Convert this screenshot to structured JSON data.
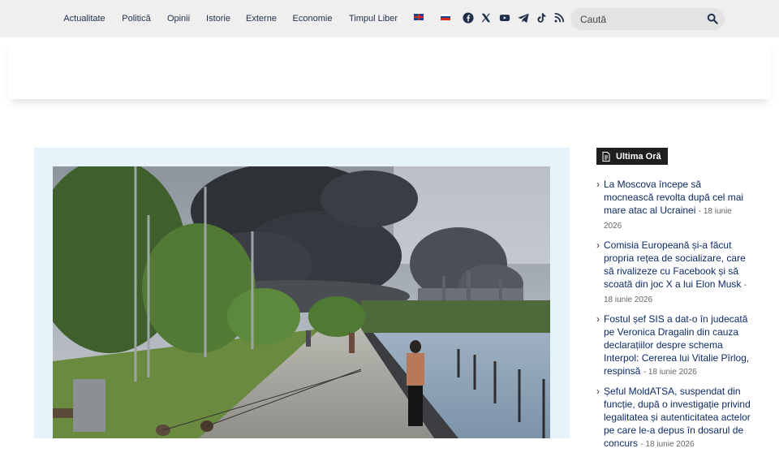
{
  "nav": {
    "items": [
      {
        "label": "Actualitate",
        "color": "#3aa6d6"
      },
      {
        "label": "Politică",
        "color": "#f2c71b"
      },
      {
        "label": "Opinii",
        "color": "#e2433e"
      },
      {
        "label": "Istorie",
        "color": "#f28b2b"
      },
      {
        "label": "Externe",
        "color": "#9b55b5"
      },
      {
        "label": "Economie",
        "color": "#46bb6e"
      },
      {
        "label": "Timpul Liber",
        "color": "#ec7fb3"
      }
    ],
    "languages": [
      "uk-flag-icon",
      "ru-flag-icon"
    ],
    "social": [
      "facebook-icon",
      "x-icon",
      "youtube-icon",
      "telegram-icon",
      "tiktok-icon",
      "rss-icon"
    ]
  },
  "search": {
    "placeholder": "Caută"
  },
  "sidebar": {
    "badge": "Ultima Oră",
    "items": [
      {
        "title": "La Moscova începe să mocnească revolta după cel mai mare atac al Ucrainei",
        "date": "18 iunie 2026"
      },
      {
        "title": "Comisia Europeană și-a făcut propria rețea de socializare, care să rivalizeze cu Facebook și să scoată din joc X a lui Elon Musk",
        "date": "18 iunie 2026"
      },
      {
        "title": "Fostul șef SIS a dat-o în judecată pe Veronica Dragalin din cauza declarațiilor despre schema Interpol: Cererea lui Vitalie Pîrlog, respinsă",
        "date": "18 iunie 2026"
      },
      {
        "title": "Șeful MoldATSA, suspendat din funcție, după o investigație privind legalitatea și autenticitatea actelor pe care le-a depus în dosarul de concurs",
        "date": "18 iunie 2026"
      }
    ]
  },
  "colors": {
    "topbar": "#efefef",
    "card": "#e6f3fb",
    "link": "#0c2a66"
  }
}
